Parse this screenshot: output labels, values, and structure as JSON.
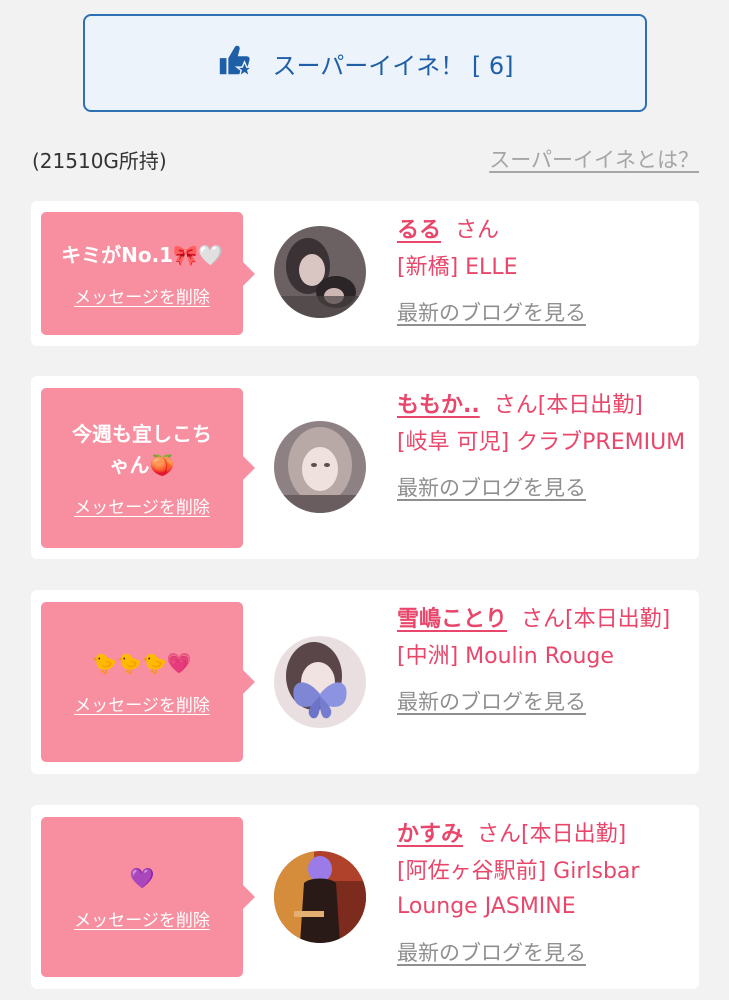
{
  "super_like": {
    "label": "スーパーイイネ！ [ 6]"
  },
  "gold_status": "(21510G所持)",
  "about_link": "スーパーイイネとは？",
  "cards": [
    {
      "message": "キミがNo.1🎀🤍",
      "delete_label": "メッセージを削除",
      "name": "るる",
      "suffix": "さん",
      "shop": "[新橋] ELLE",
      "blog_label": "最新のブログを見る"
    },
    {
      "message": "今週も宜しこちゃん🍑",
      "delete_label": "メッセージを削除",
      "name": "ももか..",
      "suffix": "さん[本日出勤]",
      "shop": "[岐阜 可児] クラブPREMIUM",
      "blog_label": "最新のブログを見る"
    },
    {
      "message": "🐤🐤🐤💗",
      "delete_label": "メッセージを削除",
      "name": "雪嶋ことり",
      "suffix": "さん[本日出勤]",
      "shop": "[中洲] Moulin Rouge",
      "blog_label": "最新のブログを見る"
    },
    {
      "message": "💜",
      "delete_label": "メッセージを削除",
      "name": "かすみ",
      "suffix": "さん[本日出勤]",
      "shop": "[阿佐ヶ谷駅前] Girlsbar Lounge JASMINE",
      "blog_label": "最新のブログを見る"
    }
  ],
  "colors": {
    "accent_pink": "#e8476b",
    "bubble_pink": "#f78fa0",
    "button_blue": "#2f6fb3"
  },
  "icons": {
    "super_like": "thumbs-up-star-icon"
  }
}
